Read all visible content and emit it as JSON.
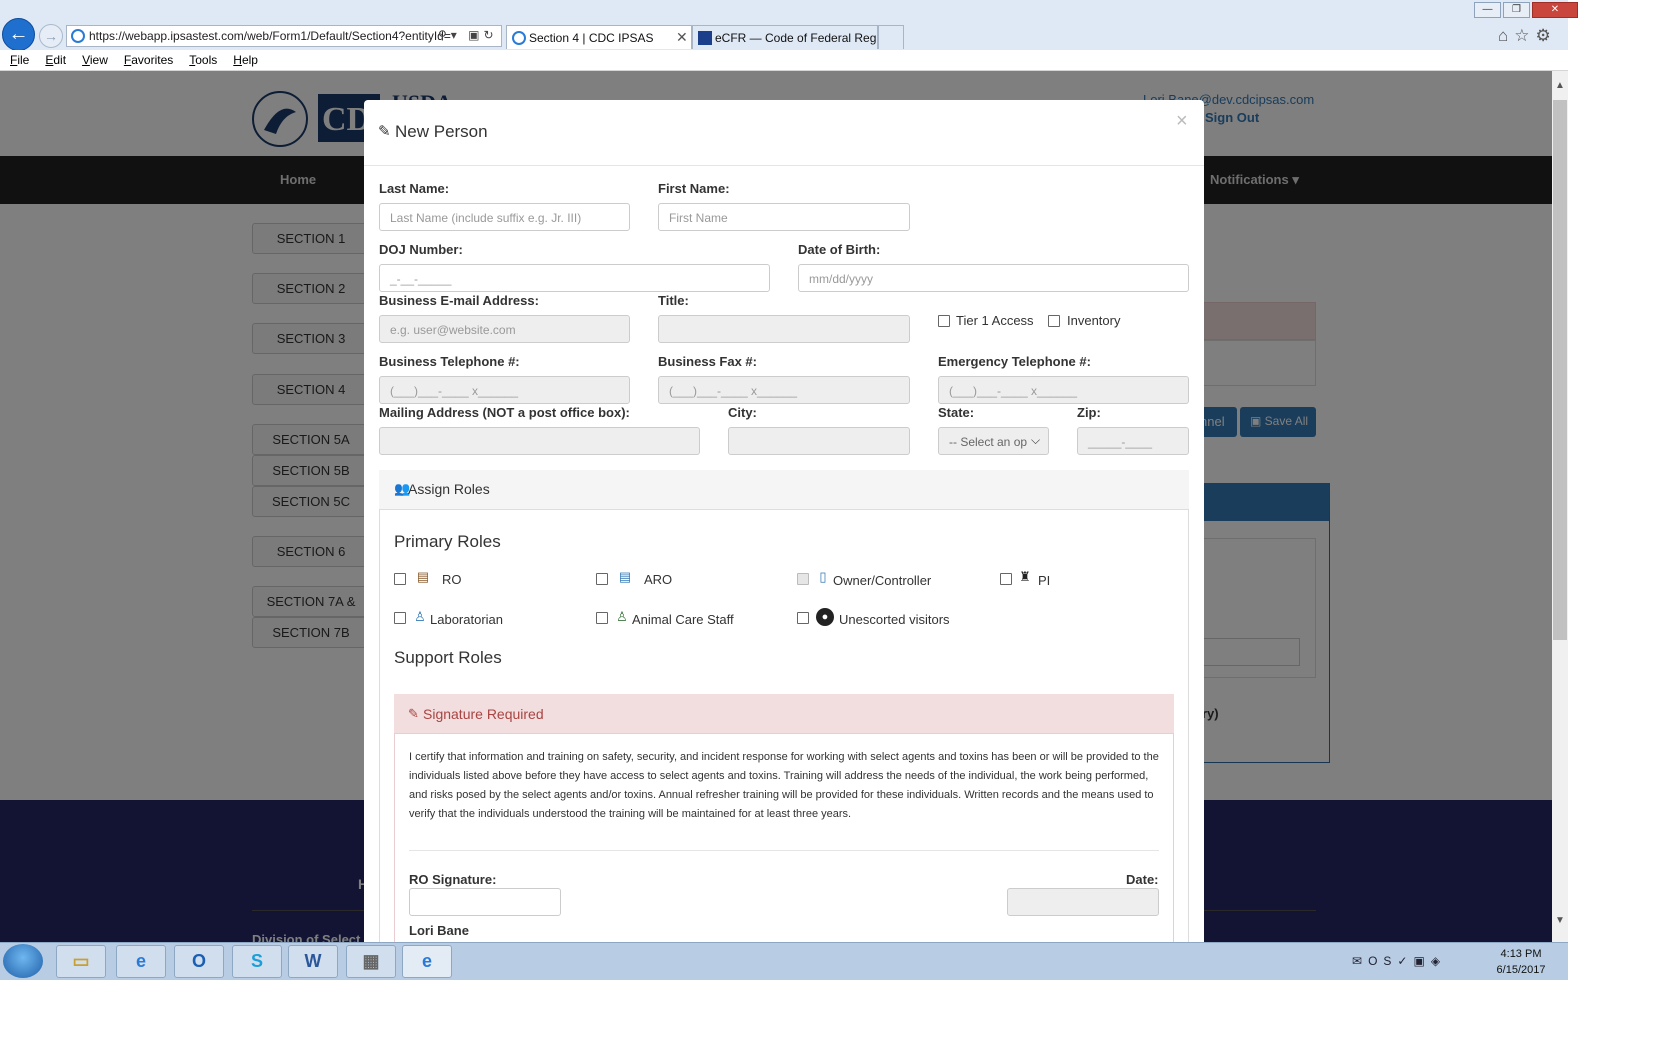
{
  "browser": {
    "address": "https://webapp.ipsastest.com/web/Form1/Default/Section4?entityId=",
    "tabs": [
      {
        "label": "Section 4 | CDC IPSAS"
      },
      {
        "label": "eCFR — Code of Federal Regul..."
      }
    ],
    "menu": [
      "File",
      "Edit",
      "View",
      "Favorites",
      "Tools",
      "Help"
    ]
  },
  "page": {
    "user": "Lori.Bane@dev.cdcipsas.com",
    "sign_out": "Sign Out",
    "nav": {
      "home": "Home",
      "notifications": "Notifications ▾"
    },
    "sections": [
      "SECTION 1",
      "SECTION 2",
      "SECTION 3",
      "SECTION 4",
      "SECTION 5A",
      "SECTION 5B",
      "SECTION 5C",
      "SECTION 6",
      "SECTION 7A &",
      "SECTION 7B"
    ],
    "channel_btn": "nnel",
    "save_all": "Save All",
    "panel_text": "ry)",
    "footer_h": "H",
    "footer_div": "Division of Select"
  },
  "modal": {
    "title": "New Person",
    "close": "×",
    "fields": {
      "last_name": {
        "label": "Last Name:",
        "placeholder": "Last Name (include suffix e.g. Jr. III)"
      },
      "first_name": {
        "label": "First Name:",
        "placeholder": "First Name"
      },
      "doj": {
        "label": "DOJ Number:",
        "placeholder": "_-__-_____"
      },
      "dob": {
        "label": "Date of Birth:",
        "placeholder": "mm/dd/yyyy"
      },
      "email": {
        "label": "Business E-mail Address:",
        "placeholder": "e.g. user@website.com"
      },
      "title": {
        "label": "Title:",
        "placeholder": ""
      },
      "tier1": "Tier 1 Access",
      "inventory": "Inventory",
      "phone": {
        "label": "Business Telephone #:",
        "placeholder": "(___)___-____ x______"
      },
      "fax": {
        "label": "Business Fax #:",
        "placeholder": "(___)___-____ x______"
      },
      "emergency": {
        "label": "Emergency Telephone #:",
        "placeholder": "(___)___-____ x______"
      },
      "mailing": {
        "label": "Mailing Address (NOT a post office box):",
        "placeholder": ""
      },
      "city": {
        "label": "City:",
        "placeholder": ""
      },
      "state": {
        "label": "State:",
        "value": "-- Select an op"
      },
      "zip": {
        "label": "Zip:",
        "placeholder": "_____-____"
      }
    },
    "roles": {
      "panel_title": "Assign Roles",
      "primary_title": "Primary Roles",
      "support_title": "Support Roles",
      "primary": [
        {
          "label": "RO",
          "icon": "id-card-icon",
          "color": "#8a5a2b"
        },
        {
          "label": "ARO",
          "icon": "id-card-icon",
          "color": "#337ab7"
        },
        {
          "label": "Owner/Controller",
          "icon": "badge-icon",
          "color": "#337ab7"
        },
        {
          "label": "PI",
          "icon": "user-secret-icon",
          "color": "#222222"
        },
        {
          "label": "Laboratorian",
          "icon": "user-md-icon",
          "color": "#337ab7"
        },
        {
          "label": "Animal Care Staff",
          "icon": "user-md-icon",
          "color": "#3c763d"
        },
        {
          "label": "Unescorted visitors",
          "icon": "user-circle-icon",
          "color": "#222222"
        }
      ]
    },
    "signature": {
      "title": "Signature Required",
      "text": "I certify that information and training on safety, security, and incident response for working with select agents and toxins has been or will be provided to the individuals listed above before they have access to select agents and toxins. Training will address the needs of the individual, the work being performed, and risks posed by the select agents and/or toxins. Annual refresher training will be provided for these individuals. Written records and the means used to verify that the individuals understood the training will be maintained for at least three years.",
      "ro_label": "RO Signature:",
      "date_label": "Date:",
      "name": "Lori Bane"
    }
  },
  "taskbar": {
    "time": "4:13 PM",
    "date": "6/15/2017"
  }
}
